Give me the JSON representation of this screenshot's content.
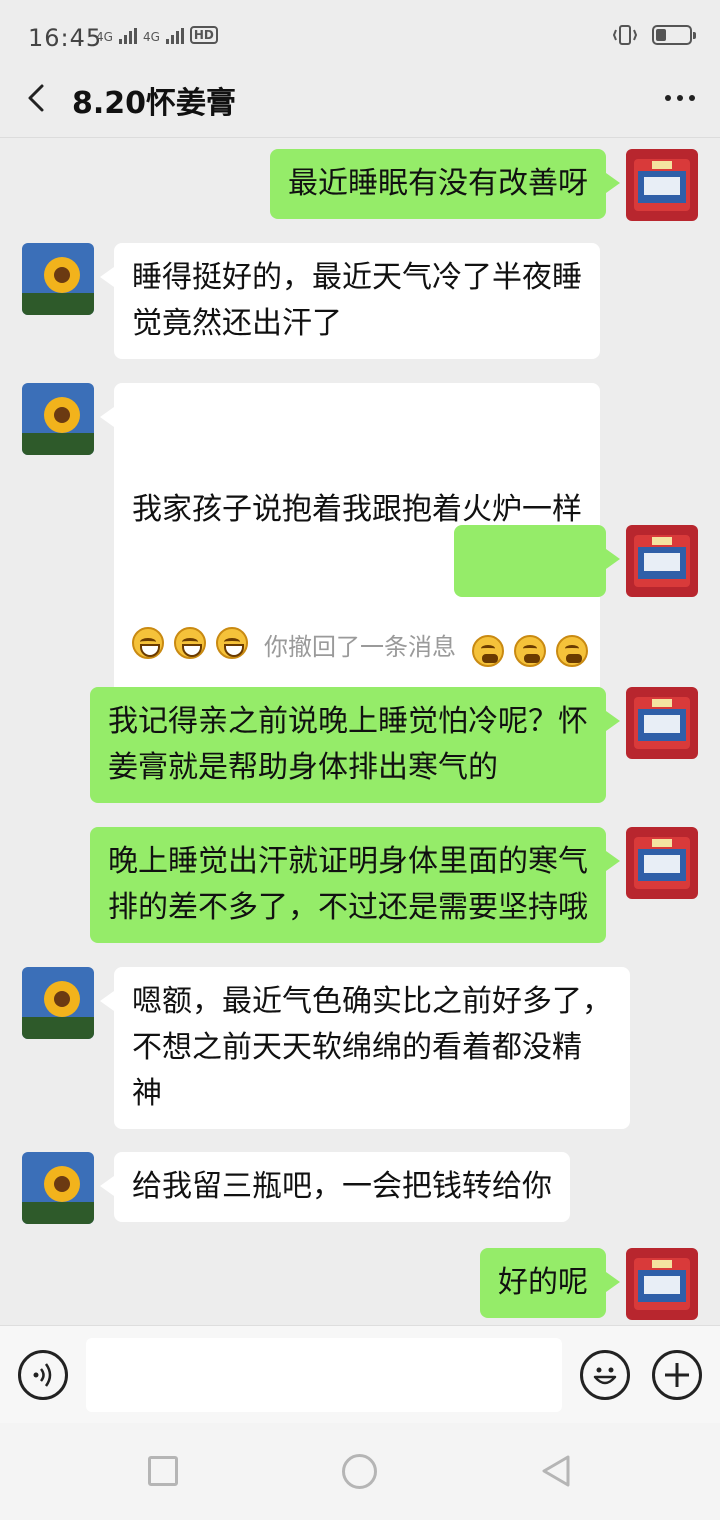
{
  "status_bar": {
    "time": "16:45",
    "network_1": "4G",
    "network_2": "4G",
    "hd_badge": "HD",
    "battery_level": 0.3
  },
  "header": {
    "title": "8.20怀姜膏"
  },
  "colors": {
    "my_bubble": "#95ec69",
    "their_bubble": "#ffffff",
    "chat_background": "#ededed"
  },
  "messages": [
    {
      "from": "me",
      "text": "最近睡眠有没有改善呀",
      "avatar": "product-box-avatar"
    },
    {
      "from": "them",
      "text": "睡得挺好的，最近天气冷了半夜睡\n觉竟然还出汗了",
      "avatar": "sunflower-avatar"
    },
    {
      "from": "them",
      "text": "我家孩子说抱着我跟抱着火炉一样",
      "emojis": [
        "grin-emoji",
        "grin-emoji",
        "grin-emoji"
      ],
      "avatar": "sunflower-avatar"
    },
    {
      "from": "me",
      "text": "",
      "emojis": [
        "thinking-emoji",
        "thinking-emoji",
        "thinking-emoji"
      ],
      "avatar": "product-box-avatar"
    },
    {
      "from": "system",
      "text": "你撤回了一条消息"
    },
    {
      "from": "me",
      "text": "我记得亲之前说晚上睡觉怕冷呢？怀\n姜膏就是帮助身体排出寒气的",
      "avatar": "product-box-avatar"
    },
    {
      "from": "me",
      "text": "晚上睡觉出汗就证明身体里面的寒气\n排的差不多了，不过还是需要坚持哦",
      "avatar": "product-box-avatar"
    },
    {
      "from": "them",
      "text": "嗯额，最近气色确实比之前好多了，\n不想之前天天软绵绵的看着都没精\n神",
      "avatar": "sunflower-avatar"
    },
    {
      "from": "them",
      "text": "给我留三瓶吧，一会把钱转给你",
      "avatar": "sunflower-avatar"
    },
    {
      "from": "me",
      "text": "好的呢",
      "avatar": "product-box-avatar"
    }
  ],
  "input": {
    "value": "",
    "placeholder": ""
  }
}
